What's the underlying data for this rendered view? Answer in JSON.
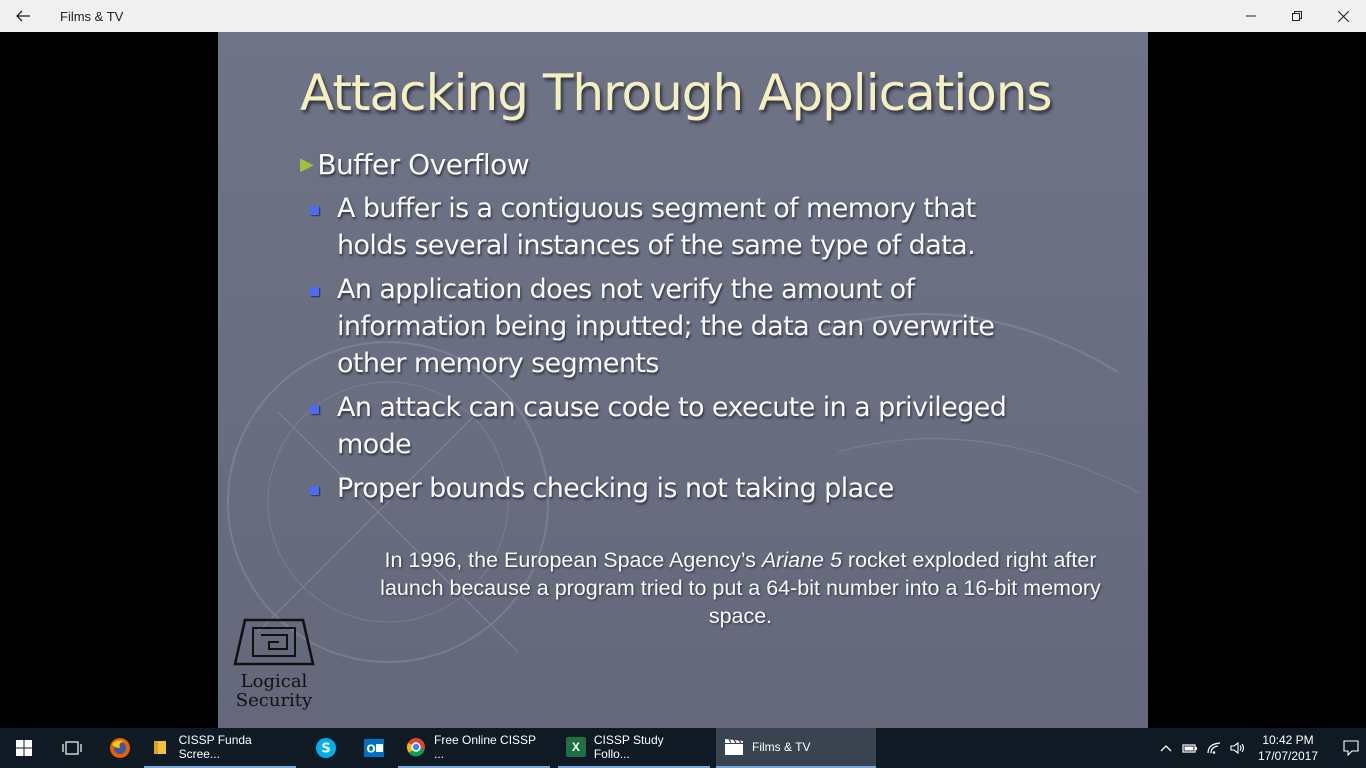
{
  "window": {
    "title": "Films & TV"
  },
  "slide": {
    "title": "Attacking Through Applications",
    "heading": "Buffer Overflow",
    "bullets": [
      "A buffer is a contiguous segment of memory that holds several instances of the same type of data.",
      "An application does not verify the amount of information being inputted; the data can overwrite other memory segments",
      "An attack can cause code to execute in a privileged mode",
      "Proper bounds checking is not taking place"
    ],
    "note_pre": "In 1996, the European Space Agency’s ",
    "note_em": "Ariane 5",
    "note_post": " rocket exploded right after launch because a program tried to put a 64-bit number into a 16-bit memory space.",
    "logo_line1": "Logical",
    "logo_line2": "Security"
  },
  "taskbar": {
    "apps": [
      {
        "label": "CISSP Funda Scree...",
        "icon": "folder-icon",
        "color": "#f0c040"
      },
      {
        "label": "Free Online CISSP ...",
        "icon": "chrome-icon",
        "color": "#ffffff"
      },
      {
        "label": "CISSP  Study Follo...",
        "icon": "excel-icon",
        "color": "#1e7145"
      },
      {
        "label": "Films & TV",
        "icon": "films-tv-icon",
        "color": "#ffffff"
      }
    ],
    "time": "10:42 PM",
    "date": "17/07/2017"
  }
}
